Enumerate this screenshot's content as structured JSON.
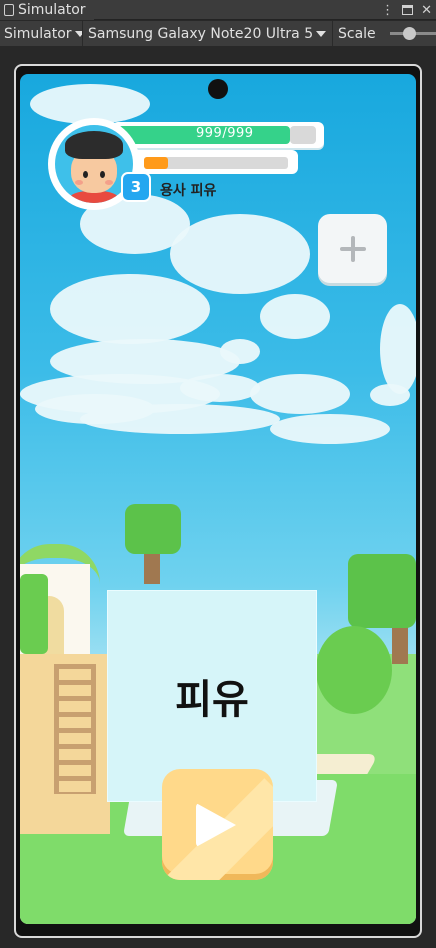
{
  "editor": {
    "window_tab": "Simulator",
    "window_controls": [
      "⋮",
      "□",
      "✕"
    ],
    "mode_dropdown": "Simulator",
    "device_dropdown": "Samsung Galaxy Note20 Ultra 5",
    "scale_label": "Scale"
  },
  "game": {
    "hp_text": "999/999",
    "hp_fraction": 1.0,
    "xp_fraction": 0.17,
    "level": "3",
    "player_name": "용사 피유",
    "nameplate": "피유"
  },
  "colors": {
    "hp": "#35d28a",
    "xp": "#ff9a1a",
    "level_badge": "#24a7f0",
    "play_button": "#ffd98a"
  },
  "icons": {
    "add": "plus-icon",
    "play": "play-icon",
    "avatar": "avatar-portrait"
  }
}
